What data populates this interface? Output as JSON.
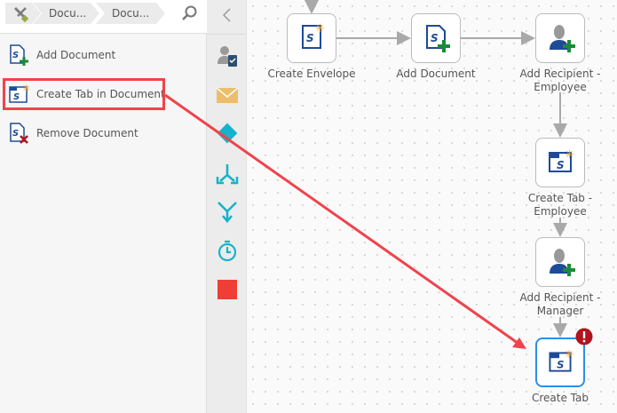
{
  "breadcrumb": {
    "items": [
      "Docu...",
      "Docu..."
    ],
    "tools_icon": "wrench-screwdriver-icon",
    "search_icon": "search-icon"
  },
  "activities": [
    {
      "label": "Add Document",
      "icon": "add-document-icon"
    },
    {
      "label": "Create Tab in Document",
      "icon": "create-tab-icon",
      "highlighted": true
    },
    {
      "label": "Remove Document",
      "icon": "remove-document-icon"
    }
  ],
  "toolbar": {
    "collapse_icon": "chevron-left-icon",
    "tools": [
      "user-task-icon",
      "envelope-icon",
      "decision-diamond-icon",
      "split-icon",
      "merge-icon",
      "timer-icon",
      "stop-icon"
    ]
  },
  "workflow": {
    "nodes": [
      {
        "label": "Create Envelope",
        "icon": "create-envelope-icon"
      },
      {
        "label": "Add Document",
        "icon": "add-document-icon"
      },
      {
        "label1": "Add Recipient -",
        "label2": "Employee",
        "icon": "add-recipient-icon"
      },
      {
        "label1": "Create Tab -",
        "label2": "Employee",
        "icon": "create-tab-icon"
      },
      {
        "label1": "Add Recipient -",
        "label2": "Manager",
        "icon": "add-recipient-icon"
      },
      {
        "label": "Create Tab",
        "icon": "create-tab-icon",
        "selected": true,
        "error": true
      }
    ]
  },
  "colors": {
    "highlight": "#f0434b",
    "selected": "#2b8fe6",
    "error": "#b0141e",
    "doc_blue": "#1f4a97",
    "plus_green": "#1a8a3a",
    "accent_orange": "#f39a1e",
    "teal": "#14b3c9"
  }
}
